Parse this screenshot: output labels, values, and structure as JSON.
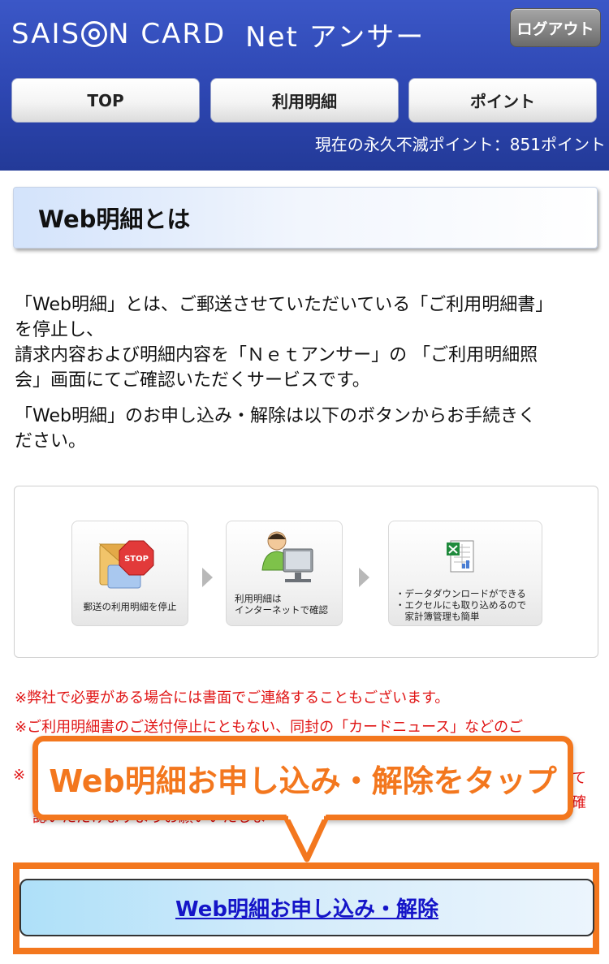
{
  "header": {
    "logo_brand_1": "SAIS",
    "logo_brand_2": "N CARD",
    "logo_sub": "Net アンサー",
    "logout_label": "ログアウト",
    "nav": {
      "top": "TOP",
      "statement": "利用明細",
      "point": "ポイント"
    },
    "points_text": "現在の永久不滅ポイント：851ポイント"
  },
  "section": {
    "title": "Web明細とは"
  },
  "description": {
    "p1_l1": "「Web明細」とは、ご郵送させていただいている「ご利用明細書」",
    "p1_l2": "を停止し、",
    "p1_l3": "請求内容および明細内容を「Ｎｅｔアンサー」の 「ご利用明細照",
    "p1_l4": "会」画面にてご確認いただくサービスです。",
    "p2_l1": "「Web明細」のお申し込み・解除は以下のボタンからお手続きく",
    "p2_l2": "ださい。"
  },
  "diagram": {
    "step1": "郵送の利用明細を停止",
    "step2_l1": "利用明細は",
    "step2_l2": "インターネットで確認",
    "step3_l1": "・データダウンロードができる",
    "step3_l2": "・エクセルにも取り込めるので",
    "step3_l3": "　家計簿管理も簡単",
    "stop_label": "STOP"
  },
  "notices": {
    "n1": "※弊社で必要がある場合には書面でご連絡することもございます。",
    "n2": "※ご利用明細書のご送付停止にともない、同封の「カードニュース」などのご",
    "n3_left": "※",
    "n3_right1": "て",
    "n3_right2": "確",
    "n3_frag": "認いただけますようお願いいたします。"
  },
  "callout": {
    "text": "Web明細お申し込み・解除をタップ"
  },
  "apply_button": {
    "label": "Web明細お申し込み・解除"
  },
  "colors": {
    "header_blue": "#2d46b1",
    "accent_orange": "#f3771e",
    "notice_red": "#e01414",
    "link_blue": "#1515c8"
  }
}
